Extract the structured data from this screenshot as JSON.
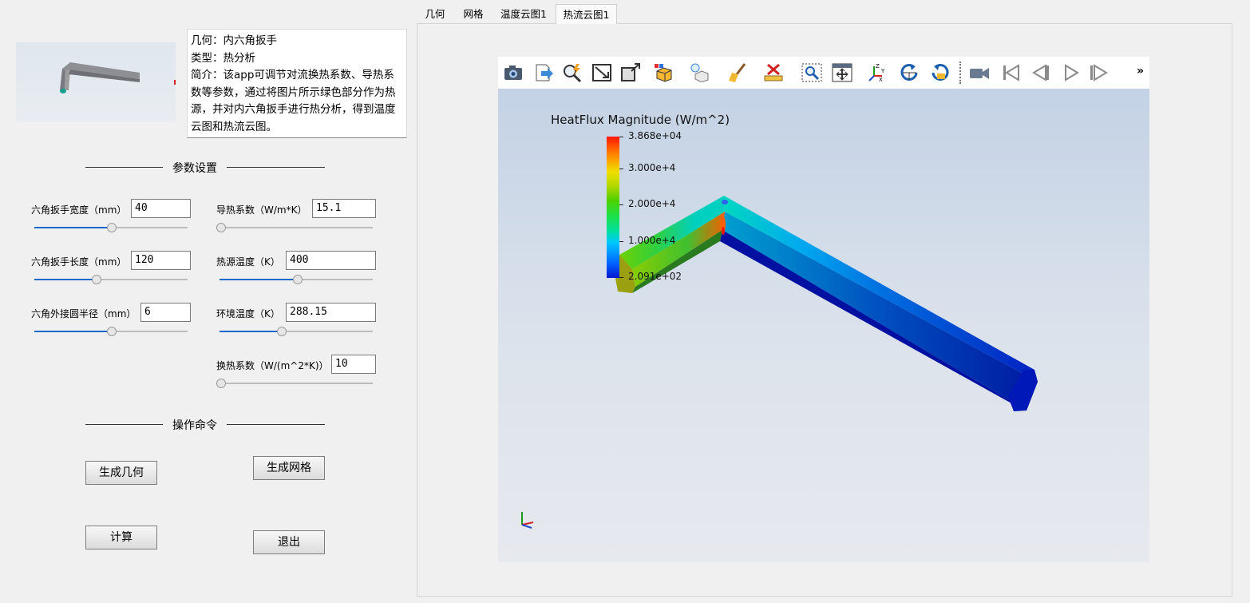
{
  "app": {
    "description": {
      "geometry": "几何：内六角扳手",
      "type": "类型：热分析",
      "intro": "简介：该app可调节对流换热系数、导热系数等参数，通过将图片所示绿色部分作为热源，并对内六角扳手进行热分析，得到温度云图和热流云图。"
    }
  },
  "sections": {
    "params_title": "参数设置",
    "commands_title": "操作命令"
  },
  "params": [
    {
      "label": "六角扳手宽度（mm）",
      "value": "40",
      "slider": 0.5
    },
    {
      "label": "六角扳手长度（mm）",
      "value": "120",
      "slider": 0.41
    },
    {
      "label": "六角外接圆半径（mm）",
      "value": "6",
      "slider": 0.5
    },
    {
      "label": "导热系数（W/m*K）",
      "value": "15.1",
      "slider": 0.0
    },
    {
      "label": "热源温度（K）",
      "value": "400",
      "slider": 0.5
    },
    {
      "label": "环境温度（K）",
      "value": "288.15",
      "slider": 0.4
    },
    {
      "label": "换热系数（W/(m^2*K)）",
      "value": "10",
      "slider": 0.0
    }
  ],
  "buttons": {
    "generate_geometry": "生成几何",
    "generate_mesh": "生成网格",
    "compute": "计算",
    "exit": "退出"
  },
  "tabs": [
    "几何",
    "网格",
    "温度云图1",
    "热流云图1"
  ],
  "active_tab": "热流云图1",
  "toolbar": {
    "icons": [
      "camera-icon",
      "export-icon",
      "query-icon",
      "fit-view-icon",
      "zoom-box-icon",
      "color-display-icon",
      "light-icon",
      "clear-icon",
      "measure-icon",
      "zoom-area-icon",
      "pan-icon",
      "axes-icon",
      "rotate-icon",
      "reset-rotate-icon",
      "record-icon",
      "first-frame-icon",
      "previous-frame-icon",
      "play-icon",
      "next-frame-icon"
    ],
    "more": "»"
  },
  "viewport": {
    "legend_title": "HeatFlux Magnitude (W/m^2)",
    "legend_ticks": [
      "3.868e+04",
      "3.000e+4",
      "2.000e+4",
      "1.000e+4",
      "2.091e+02"
    ],
    "colors": {
      "max": "#ff1400",
      "min": "#0018d0"
    }
  }
}
